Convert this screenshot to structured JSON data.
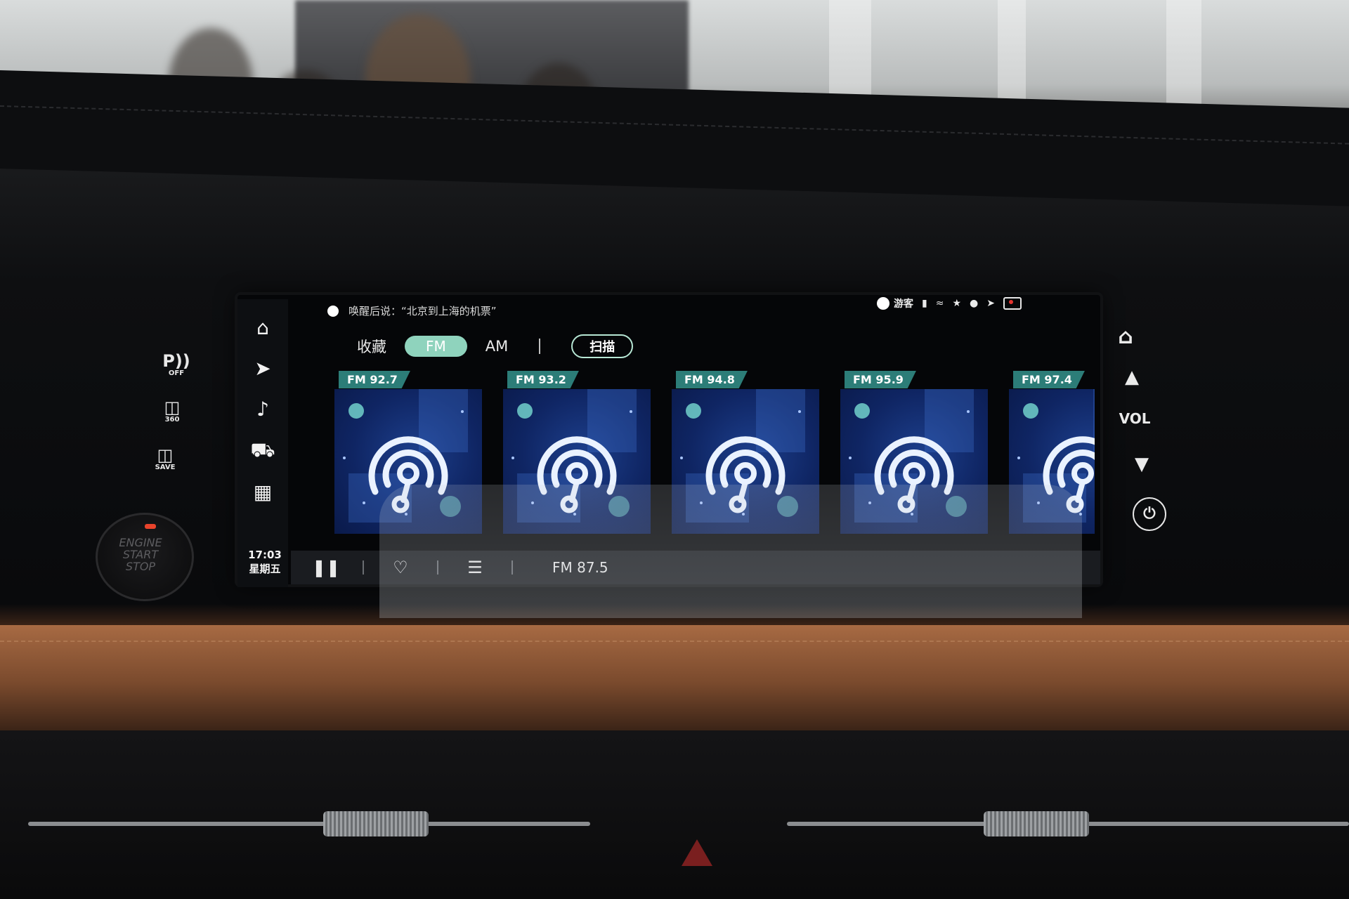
{
  "wake_hint": "唤醒后说：“北京到上海的机票”",
  "status": {
    "user": "游客"
  },
  "left_panel": {
    "park_sub": "OFF",
    "cam360_sub": "360",
    "save_sub": "SAVE",
    "engine_lines": [
      "ENGINE",
      "START",
      "STOP"
    ]
  },
  "sidebar": {
    "icons": [
      "home-icon",
      "navigation-icon",
      "music-icon",
      "car-icon",
      "apps-icon"
    ],
    "time": "17:03",
    "day": "星期五"
  },
  "tabs": {
    "favorites": "收藏",
    "fm": "FM",
    "am": "AM",
    "active": "FM",
    "scan": "扫描"
  },
  "stations": [
    {
      "label": "FM 92.7"
    },
    {
      "label": "FM 93.2"
    },
    {
      "label": "FM 94.8"
    },
    {
      "label": "FM 95.9"
    },
    {
      "label": "FM 97.4"
    }
  ],
  "playbar": {
    "current": "FM 87.5"
  },
  "right_panel": {
    "vol": "VOL"
  },
  "colors": {
    "accent": "#8fd3bd",
    "freq_tag": "#2c7d78",
    "card_bg": "#0f2563",
    "logo": "#eaf2ff"
  }
}
